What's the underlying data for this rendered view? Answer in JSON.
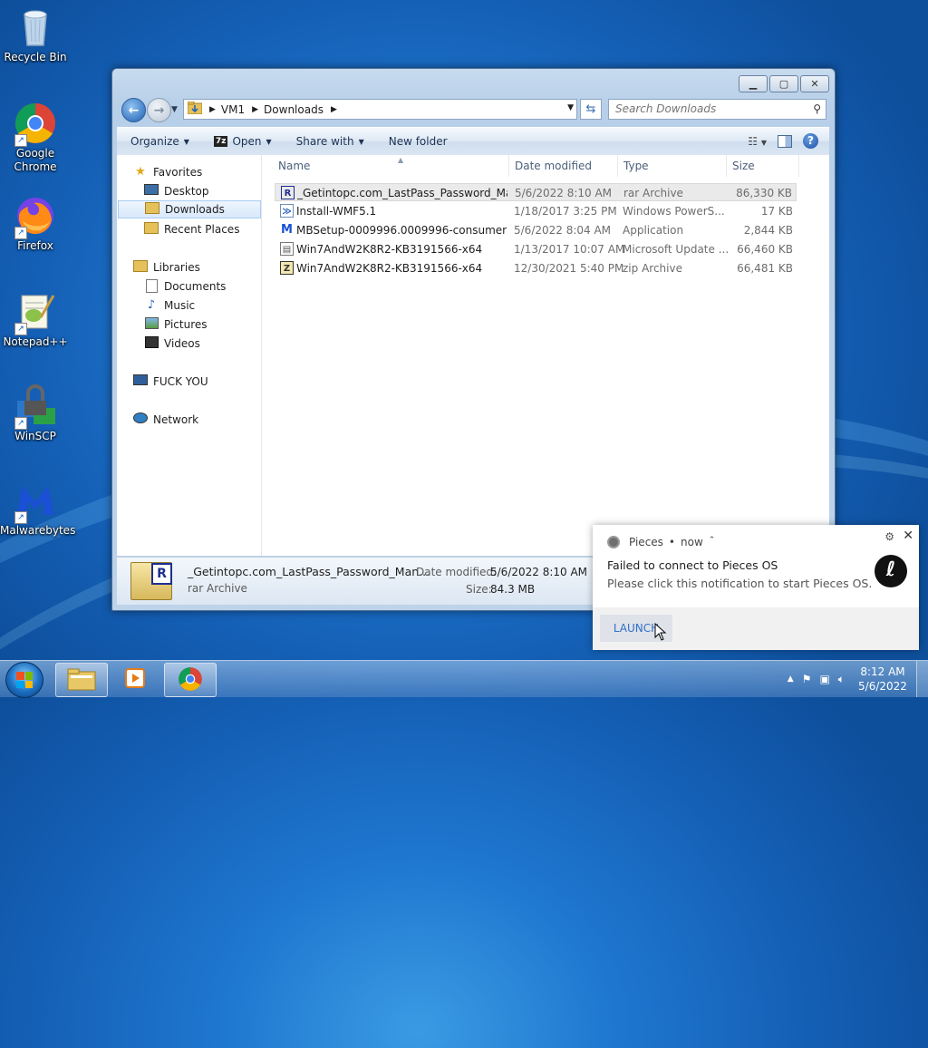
{
  "desktop": {
    "icons": [
      {
        "label": "Recycle Bin"
      },
      {
        "label": "Google Chrome"
      },
      {
        "label": "Firefox"
      },
      {
        "label": "Notepad++"
      },
      {
        "label": "WinSCP"
      },
      {
        "label": "Malwarebytes"
      }
    ]
  },
  "explorer": {
    "address": {
      "crumbs": [
        "VM1",
        "Downloads"
      ]
    },
    "search_placeholder": "Search Downloads",
    "commands": {
      "organize": "Organize",
      "open": "Open",
      "share_with": "Share with",
      "new_folder": "New folder"
    },
    "nav": {
      "favorites": "Favorites",
      "desktop": "Desktop",
      "downloads": "Downloads",
      "recent_places": "Recent Places",
      "libraries": "Libraries",
      "documents": "Documents",
      "music": "Music",
      "pictures": "Pictures",
      "videos": "Videos",
      "computer": "FUCK YOU",
      "network": "Network"
    },
    "columns": {
      "name": "Name",
      "date": "Date modified",
      "type": "Type",
      "size": "Size"
    },
    "files": [
      {
        "name": "_Getintopc.com_LastPass_Password_Man...",
        "date": "5/6/2022 8:10 AM",
        "type": "rar Archive",
        "size": "86,330 KB"
      },
      {
        "name": "Install-WMF5.1",
        "date": "1/18/2017 3:25 PM",
        "type": "Windows PowerS...",
        "size": "17 KB"
      },
      {
        "name": "MBSetup-0009996.0009996-consumer",
        "date": "5/6/2022 8:04 AM",
        "type": "Application",
        "size": "2,844 KB"
      },
      {
        "name": "Win7AndW2K8R2-KB3191566-x64",
        "date": "1/13/2017 10:07 AM",
        "type": "Microsoft Update ...",
        "size": "66,460 KB"
      },
      {
        "name": "Win7AndW2K8R2-KB3191566-x64",
        "date": "12/30/2021 5:40 PM",
        "type": "zip Archive",
        "size": "66,481 KB"
      }
    ],
    "details": {
      "name": "_Getintopc.com_LastPass_Password_Man...",
      "type": "rar Archive",
      "date_label": "Date modified:",
      "date_value": "5/6/2022 8:10 AM",
      "size_label": "Size:",
      "size_value": "84.3 MB"
    }
  },
  "notification": {
    "app": "Pieces",
    "time": "now",
    "title": "Failed to connect to Pieces OS",
    "body": "Please click this notification to start Pieces OS.",
    "action": "LAUNCH"
  },
  "taskbar": {
    "time": "8:12 AM",
    "date": "5/6/2022"
  },
  "colors": {
    "desktop_bg": "#1f77cf",
    "selection": "#d9e8fb",
    "launch_text": "#2f6fc8"
  }
}
